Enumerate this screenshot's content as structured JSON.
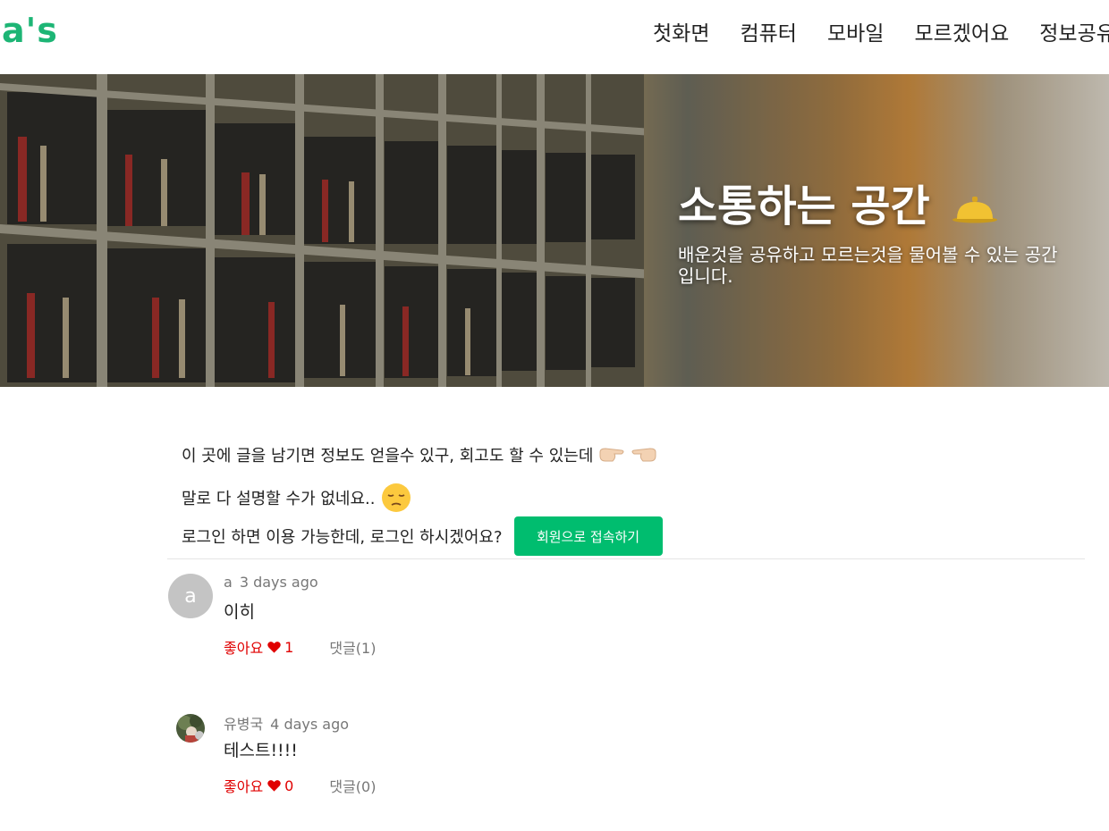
{
  "header": {
    "logo": "a's",
    "nav": [
      "첫화면",
      "컴퓨터",
      "모바일",
      "모르겠어요",
      "정보공유"
    ]
  },
  "hero": {
    "title": "소통하는 공간",
    "subtitle": "배운것을 공유하고 모르는것을 물어볼 수 있는 공간입니다."
  },
  "intro": {
    "line1": "이 곳에 글을 남기면 정보도 얻을수 있구, 회고도 할 수 있는데",
    "line2": "말로 다 설명할 수가 없네요..",
    "login_text": "로그인 하면 이용 가능한데, 로그인 하시겠어요?",
    "login_button": "회원으로 접속하기"
  },
  "posts": [
    {
      "avatar": "a",
      "author": "a",
      "time": "3 days ago",
      "content": "이히",
      "like_label": "좋아요",
      "likes": "1",
      "comments": "댓글(1)"
    },
    {
      "avatar": "",
      "author": "유병국",
      "time": "4 days ago",
      "content": "테스트!!!!",
      "like_label": "좋아요",
      "likes": "0",
      "comments": "댓글(0)"
    }
  ],
  "colors": {
    "brand": "#1db575",
    "button": "#00bd6f",
    "like": "#e00000"
  },
  "icons": [
    "bell-icon",
    "pointing-hands-icon",
    "pensive-face-icon",
    "heart-icon"
  ]
}
